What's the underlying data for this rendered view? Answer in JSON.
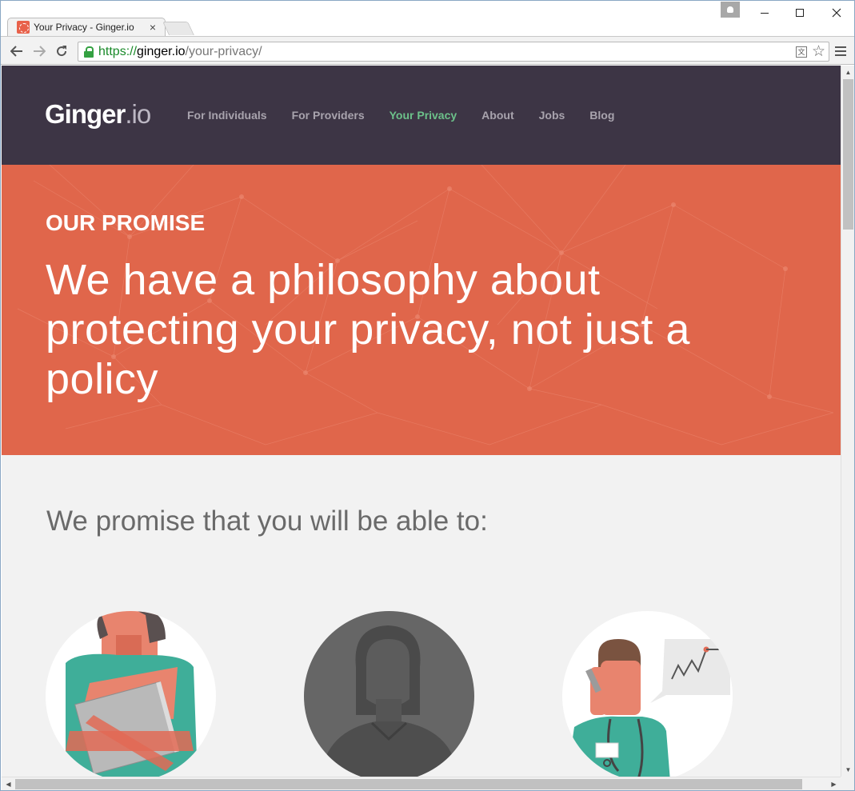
{
  "browser": {
    "tab_title": "Your Privacy - Ginger.io",
    "tab_close": "×",
    "url_scheme": "https://",
    "url_host": "ginger.io",
    "url_path": "/your-privacy/",
    "back_icon": "arrow-left-icon",
    "forward_icon": "arrow-right-icon",
    "reload_icon": "reload-icon",
    "star_icon": "star-icon",
    "menu_icon": "hamburger-menu-icon",
    "translate_icon": "translate-icon",
    "lock_color": "#34a142"
  },
  "site": {
    "logo_main": "Ginger",
    "logo_dot": ".io",
    "nav": [
      {
        "label": "For Individuals",
        "active": false
      },
      {
        "label": "For Providers",
        "active": false
      },
      {
        "label": "Your Privacy",
        "active": true
      },
      {
        "label": "About",
        "active": false
      },
      {
        "label": "Jobs",
        "active": false
      },
      {
        "label": "Blog",
        "active": false
      }
    ],
    "header_color": "#3d3545",
    "active_nav_color": "#6cc18a"
  },
  "hero": {
    "eyebrow": "OUR PROMISE",
    "title": "We have a philosophy about protecting your privacy, not just a policy",
    "background_color": "#e0664b"
  },
  "main": {
    "promise_heading": "We promise that you will be able to:",
    "illustrations": [
      {
        "name": "person-hugging-folder-illustration"
      },
      {
        "name": "person-silhouette-illustration"
      },
      {
        "name": "clinician-on-phone-illustration"
      }
    ]
  }
}
